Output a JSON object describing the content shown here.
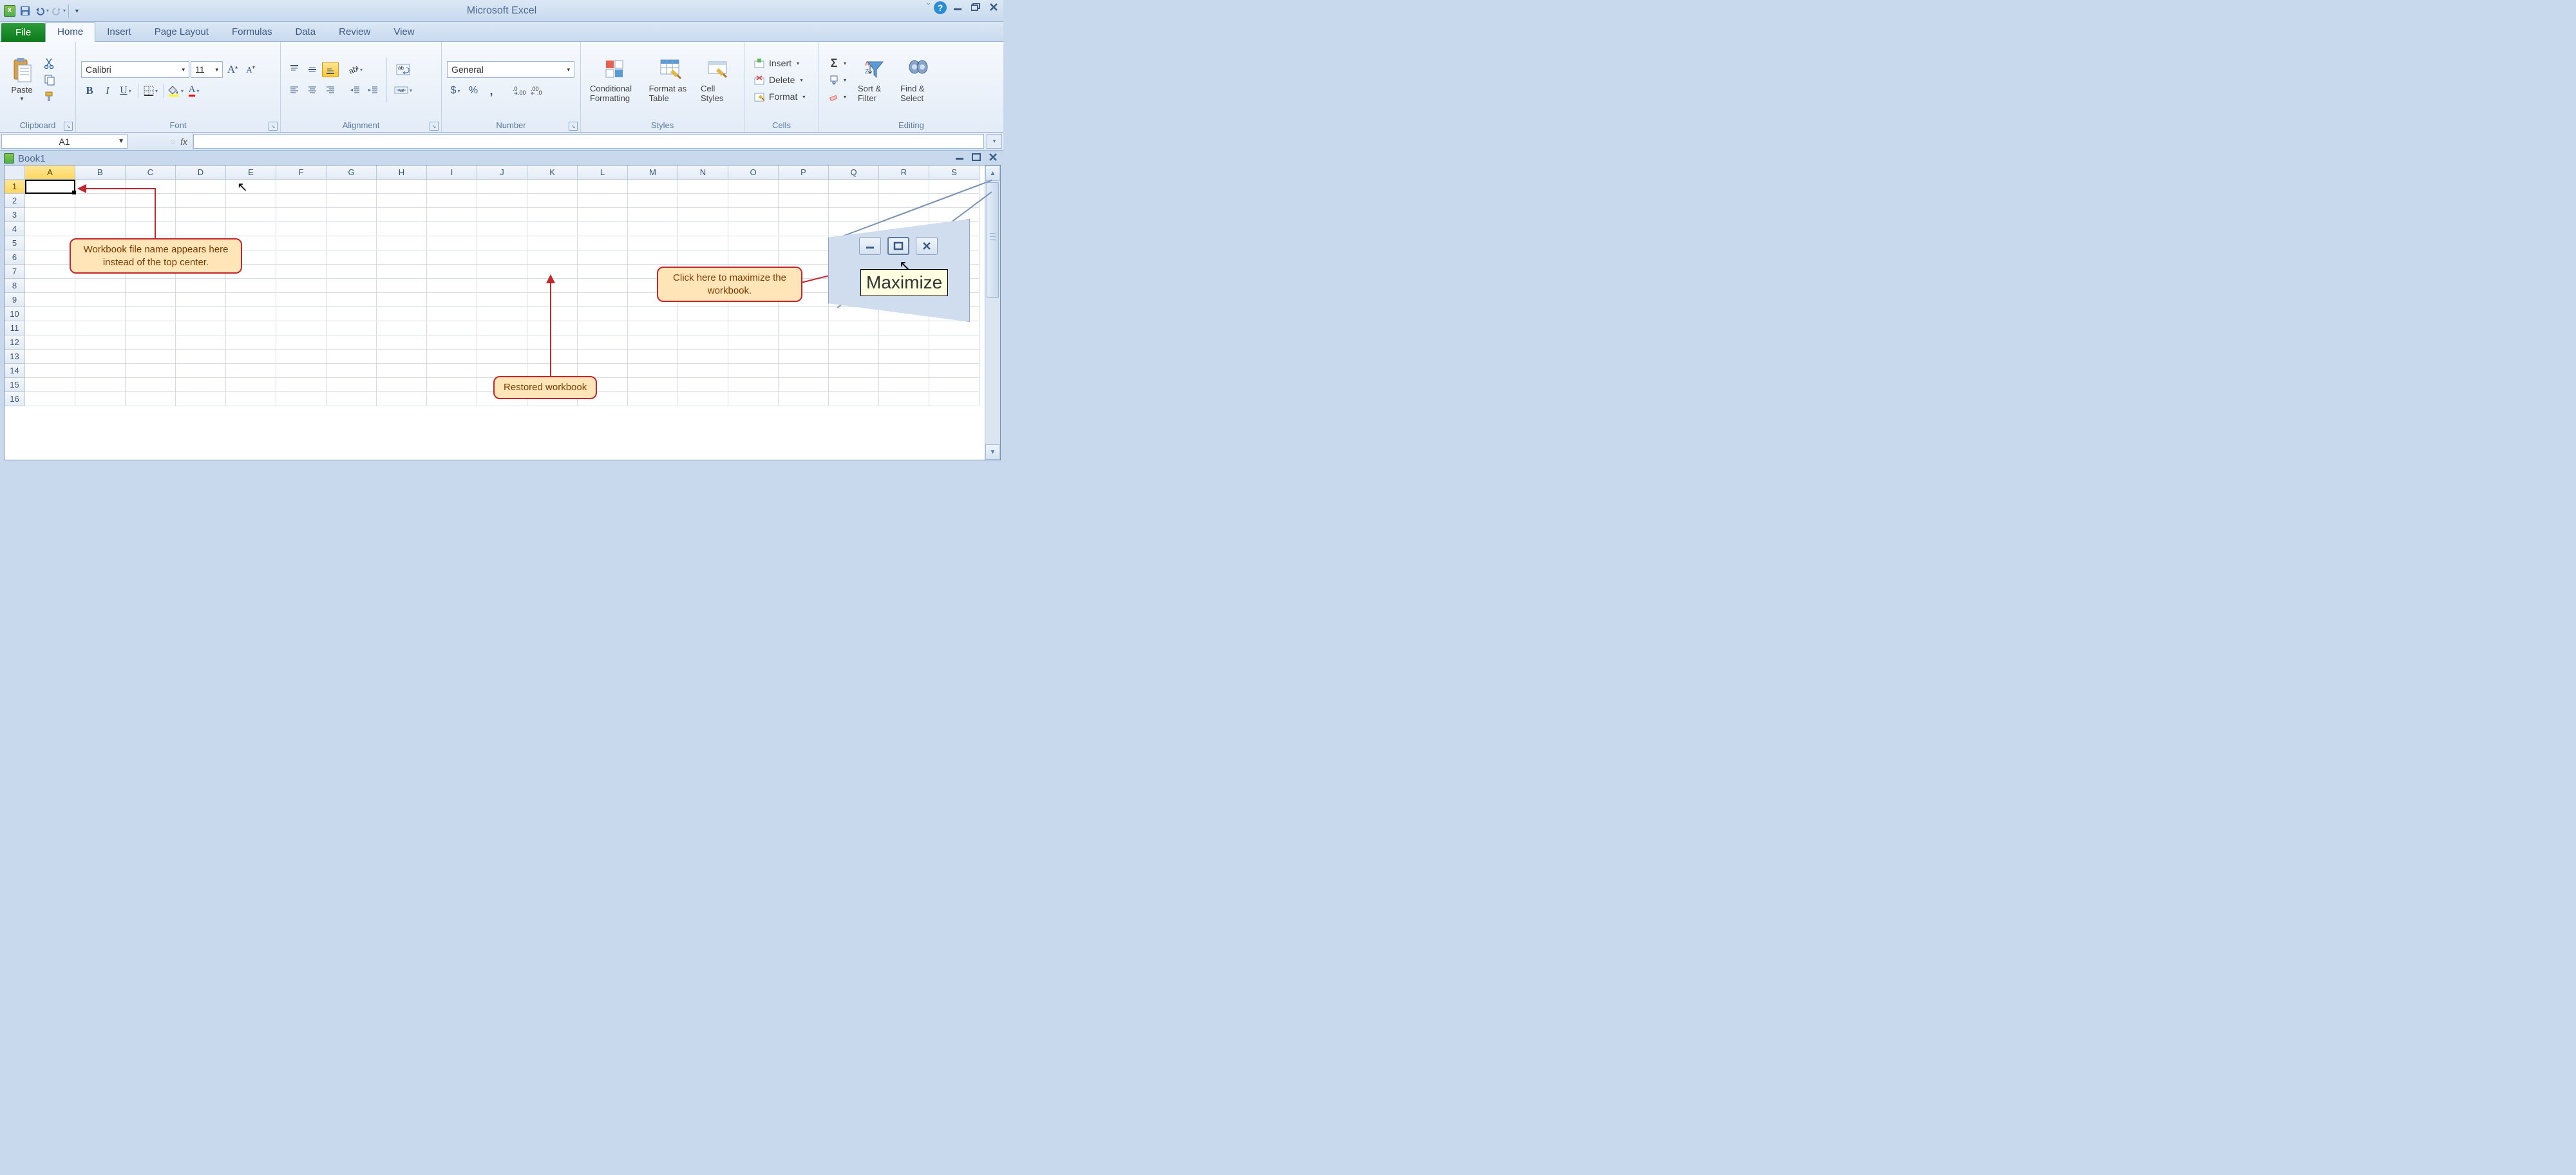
{
  "app_title": "Microsoft Excel",
  "qat": {
    "save": "Save",
    "undo": "Undo",
    "redo": "Redo"
  },
  "tabs": {
    "file": "File",
    "items": [
      "Home",
      "Insert",
      "Page Layout",
      "Formulas",
      "Data",
      "Review",
      "View"
    ],
    "active": "Home"
  },
  "ribbon": {
    "clipboard": {
      "label": "Clipboard",
      "paste": "Paste"
    },
    "font": {
      "label": "Font",
      "name": "Calibri",
      "size": "11"
    },
    "alignment": {
      "label": "Alignment"
    },
    "number": {
      "label": "Number",
      "format": "General"
    },
    "styles": {
      "label": "Styles",
      "conditional": "Conditional Formatting",
      "table": "Format as Table",
      "cell": "Cell Styles"
    },
    "cells": {
      "label": "Cells",
      "insert": "Insert",
      "delete": "Delete",
      "format": "Format"
    },
    "editing": {
      "label": "Editing",
      "sort": "Sort & Filter",
      "find": "Find & Select"
    }
  },
  "name_box": "A1",
  "fx_label": "fx",
  "workbook": {
    "name": "Book1",
    "columns": [
      "A",
      "B",
      "C",
      "D",
      "E",
      "F",
      "G",
      "H",
      "I",
      "J",
      "K",
      "L",
      "M",
      "N",
      "O",
      "P",
      "Q",
      "R",
      "S"
    ],
    "rows": [
      "1",
      "2",
      "3",
      "4",
      "5",
      "6",
      "7",
      "8",
      "9",
      "10",
      "11",
      "12",
      "13",
      "14",
      "15",
      "16"
    ],
    "active_col": "A",
    "active_row": "1"
  },
  "callouts": {
    "filename": "Workbook file name appears here instead of the top center.",
    "restored": "Restored workbook",
    "maximize": "Click here to maximize the workbook."
  },
  "inset": {
    "tooltip": "Maximize"
  }
}
